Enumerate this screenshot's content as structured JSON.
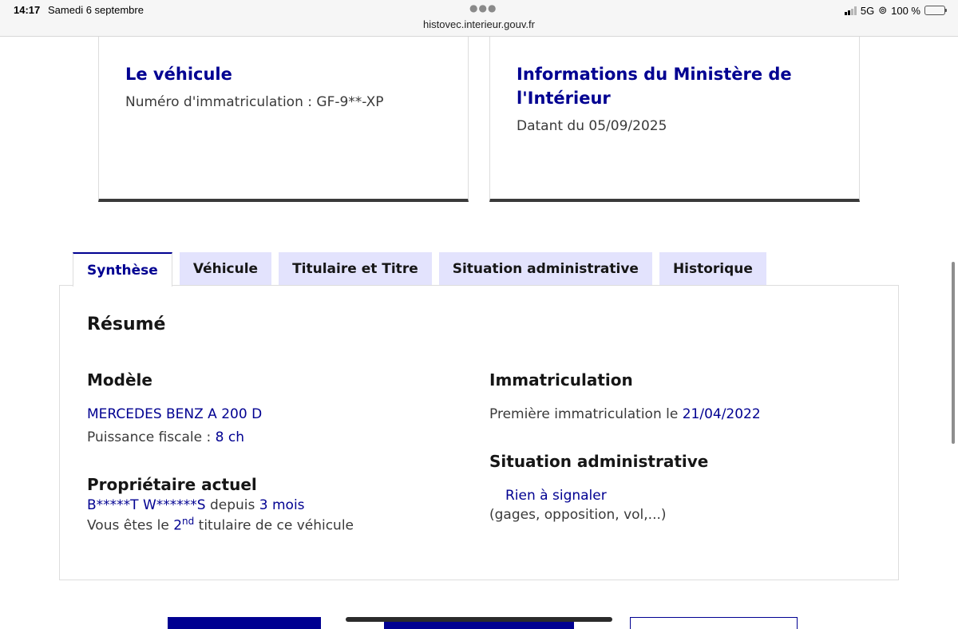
{
  "status_bar": {
    "time": "14:17",
    "date": "Samedi 6 septembre",
    "url": "histovec.interieur.gouv.fr",
    "network": "5G",
    "battery": "100 %",
    "battery_level": 1.0
  },
  "cards": [
    {
      "title": "Le véhicule",
      "text": "Numéro d'immatriculation : GF-9**-XP"
    },
    {
      "title": "Informations du Ministère de l'Intérieur",
      "text": "Datant du 05/09/2025"
    }
  ],
  "tabs": [
    {
      "label": "Synthèse",
      "active": true
    },
    {
      "label": "Véhicule",
      "active": false
    },
    {
      "label": "Titulaire et Titre",
      "active": false
    },
    {
      "label": "Situation administrative",
      "active": false
    },
    {
      "label": "Historique",
      "active": false
    }
  ],
  "summary": {
    "title": "Résumé",
    "model": {
      "heading": "Modèle",
      "name": "MERCEDES BENZ A 200 D",
      "power_label": "Puissance fiscale : ",
      "power_value": "8 ch"
    },
    "owner": {
      "heading": "Propriétaire actuel",
      "name": "B*****T W******S",
      "since_label": " depuis ",
      "since_value": "3 mois",
      "rank_prefix": "Vous êtes le ",
      "rank_number": "2",
      "rank_sup": "nd",
      "rank_suffix": " titulaire de ce véhicule"
    },
    "registration": {
      "heading": "Immatriculation",
      "first_label": "Première immatriculation le ",
      "first_date": "21/04/2022"
    },
    "admin": {
      "heading": "Situation administrative",
      "status": "Rien à signaler",
      "details": "(gages, opposition, vol,...)"
    }
  }
}
